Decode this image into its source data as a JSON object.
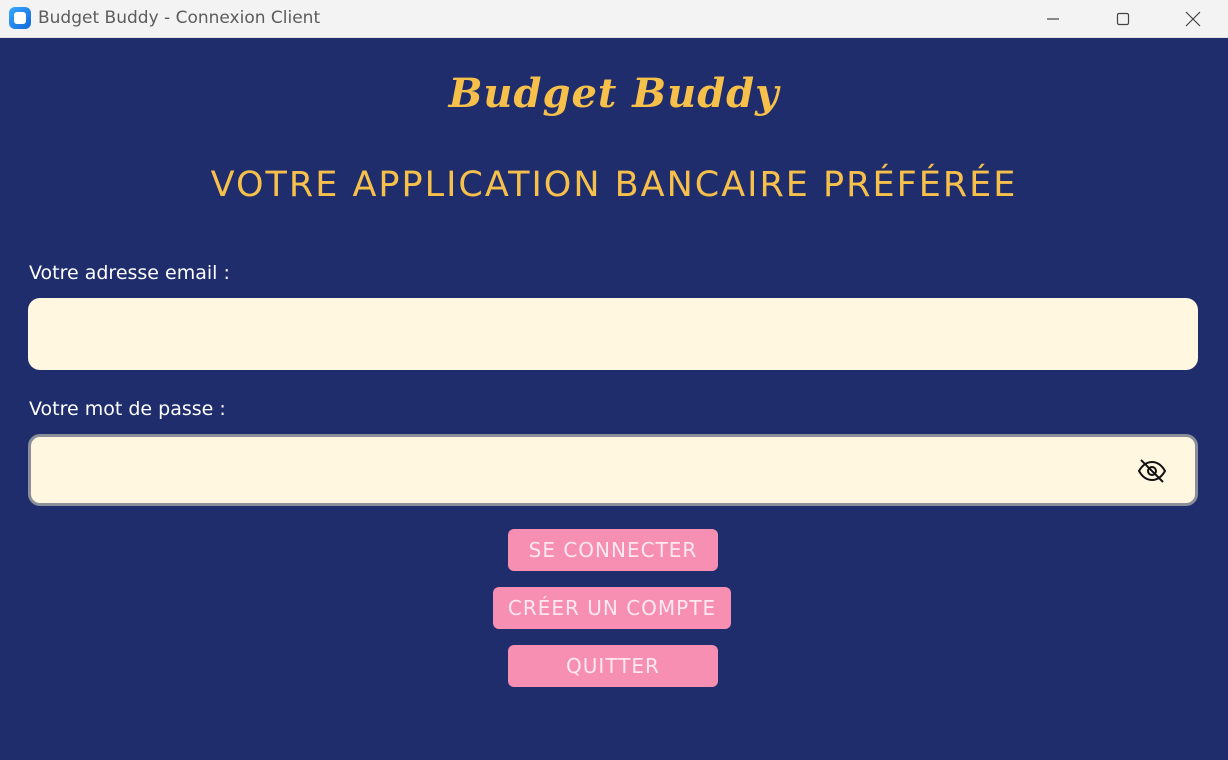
{
  "window": {
    "title": "Budget Buddy - Connexion Client",
    "icons": {
      "app": "app-icon",
      "minimize": "minimize-icon",
      "maximize": "maximize-icon",
      "close": "close-icon"
    }
  },
  "colors": {
    "background": "#1f2d6d",
    "accent": "#f7c04a",
    "input_bg": "#fff7e0",
    "button_bg": "#f78fb3",
    "button_text": "#ffe8ef"
  },
  "header": {
    "brand": "Budget Buddy",
    "tagline": "VOTRE APPLICATION BANCAIRE PRÉFÉRÉE"
  },
  "form": {
    "email_label": "Votre adresse email :",
    "email_value": "",
    "password_label": "Votre mot de passe :",
    "password_value": "",
    "password_toggle_icon": "eye-slash-icon"
  },
  "actions": {
    "login_label": "SE CONNECTER",
    "create_label": "CRÉER UN COMPTE",
    "quit_label": "QUITTER"
  }
}
